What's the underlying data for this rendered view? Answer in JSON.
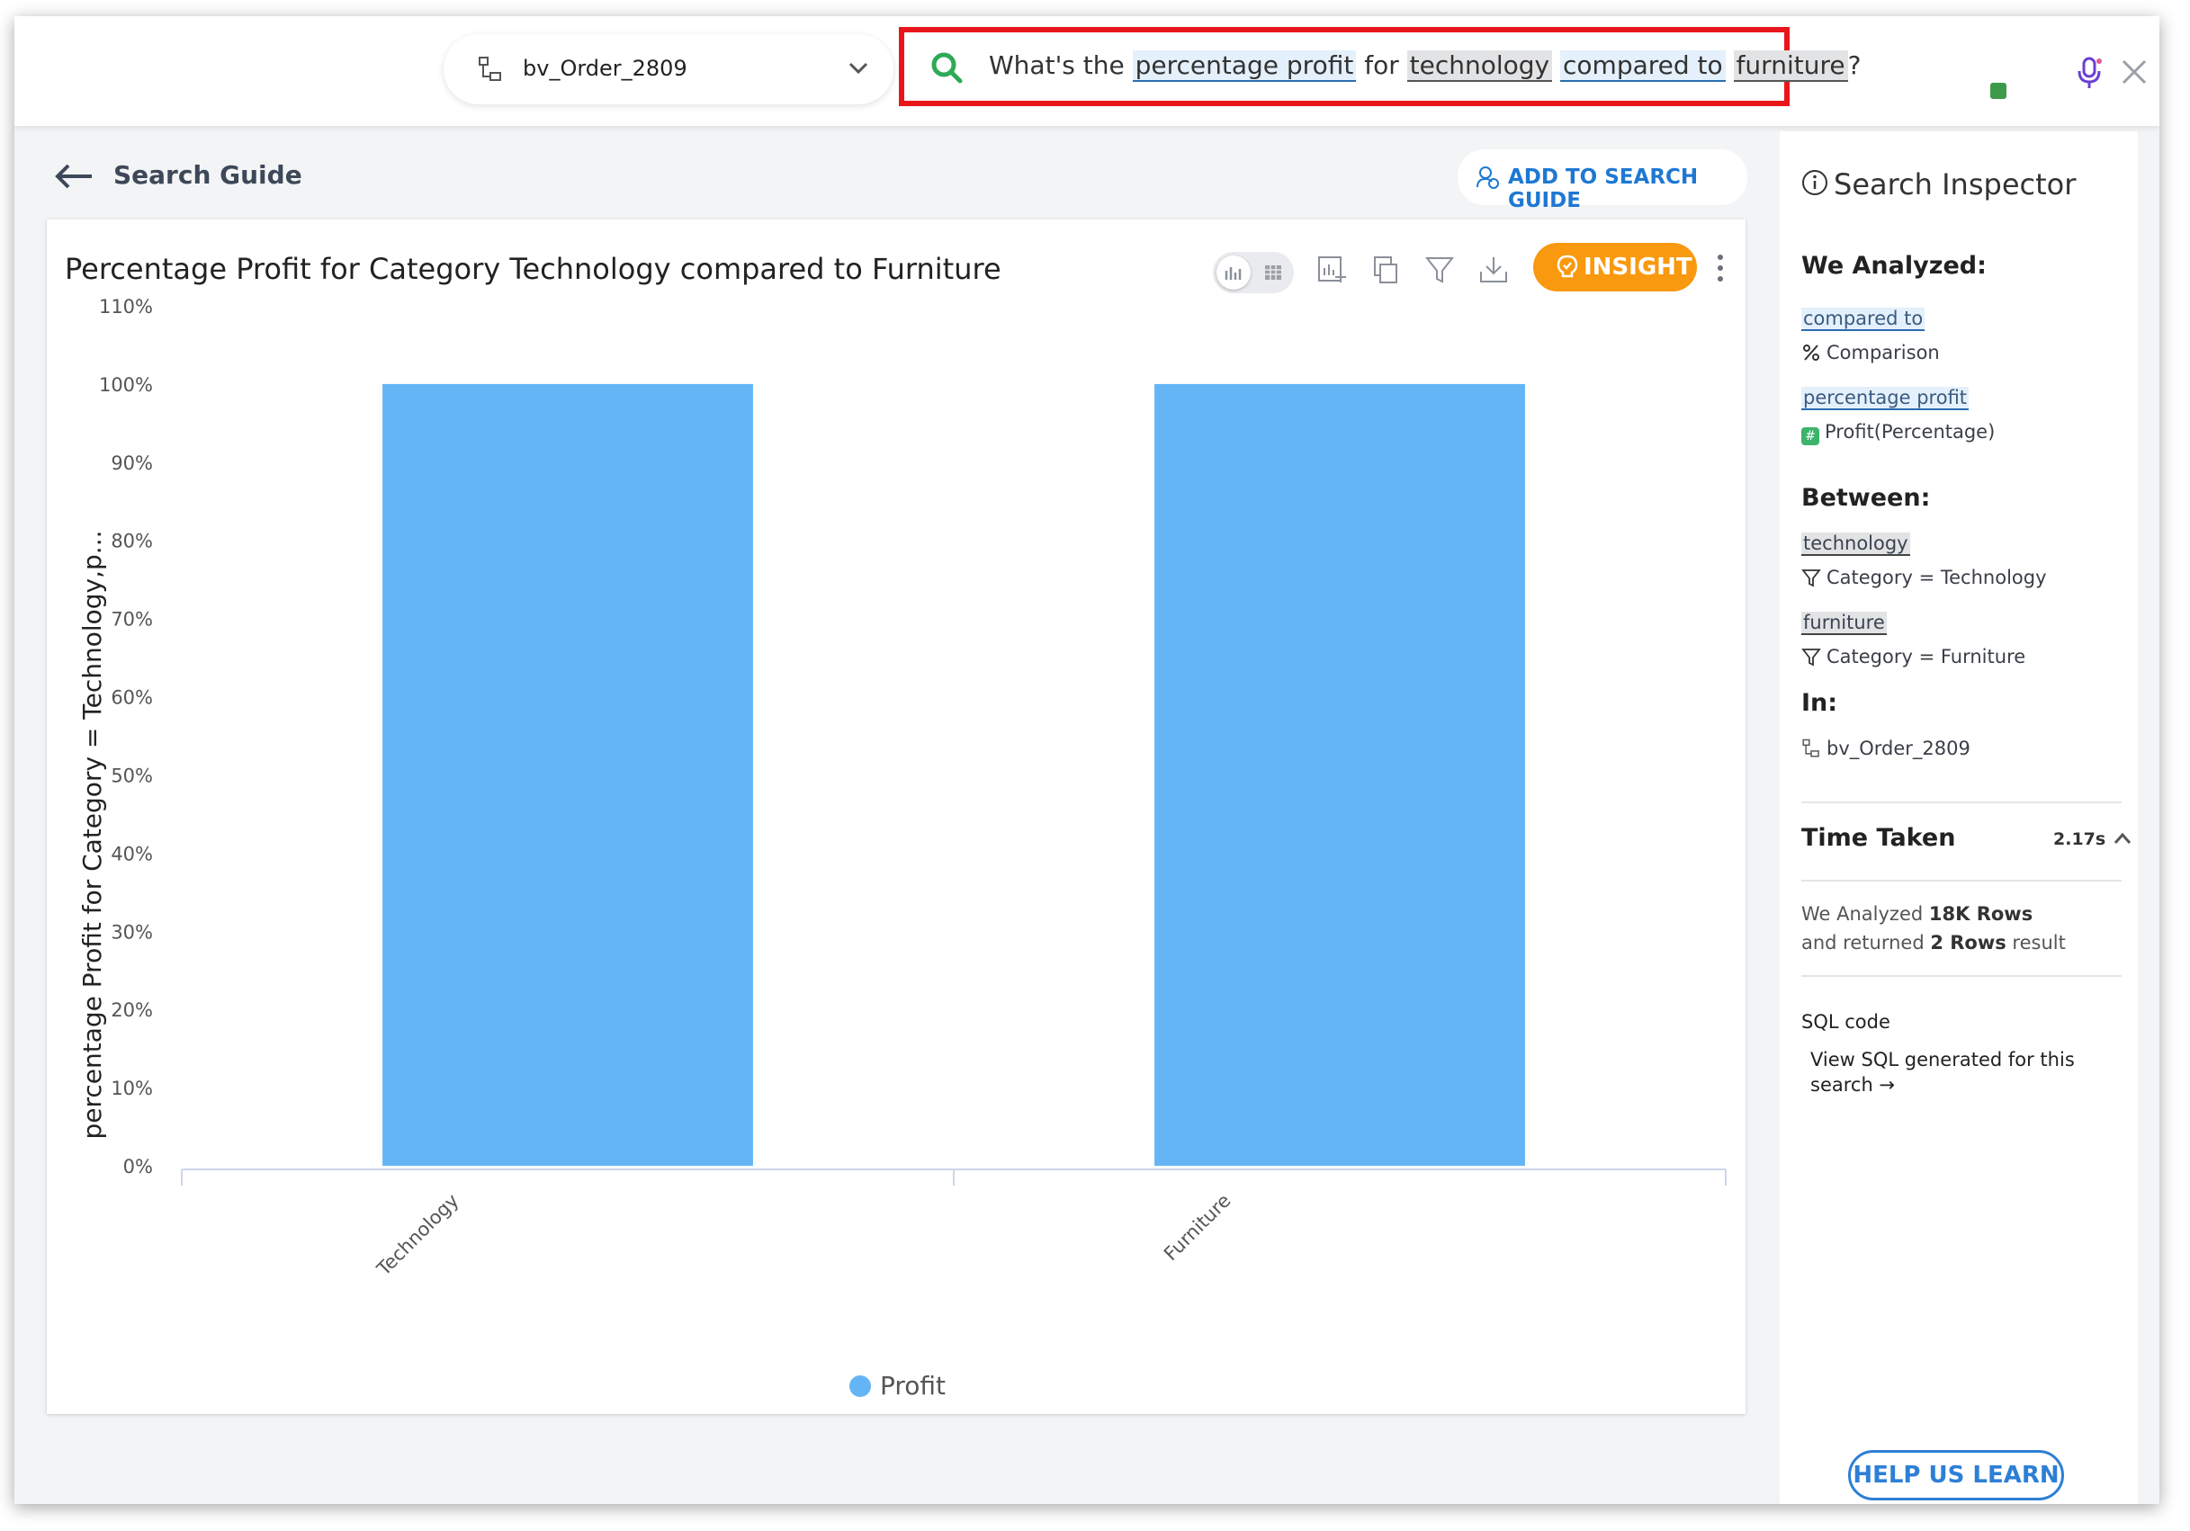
{
  "topbar": {
    "dataset_name": "bv_Order_2809",
    "query": {
      "prefix": "What's the ",
      "tok1": "percentage profit",
      "mid1": " for ",
      "tok2": "technology",
      "mid2": " ",
      "tok3": "compared to",
      "mid3": " ",
      "tok4": "furniture",
      "suffix": "?"
    }
  },
  "guide": {
    "back_label": "Search Guide",
    "add_label": "ADD TO SEARCH GUIDE"
  },
  "card": {
    "insight_label": "INSIGHT"
  },
  "chart_data": {
    "type": "bar",
    "title": "Percentage Profit for Category Technology compared to Furniture",
    "categories": [
      "Technology",
      "Furniture"
    ],
    "series": [
      {
        "name": "Profit",
        "values": [
          100,
          100
        ],
        "color": "#64b5f6"
      }
    ],
    "ylabel": "percentage Profit for Category = Technology,p...",
    "xlabel": "",
    "ylim": [
      0,
      110
    ],
    "yticks": [
      "0%",
      "10%",
      "20%",
      "30%",
      "40%",
      "50%",
      "60%",
      "70%",
      "80%",
      "90%",
      "100%",
      "110%"
    ],
    "legend": "bottom-center",
    "grid": false
  },
  "inspector": {
    "title": "Search Inspector",
    "analyzed_heading": "We Analyzed:",
    "items": [
      {
        "token": "compared to",
        "desc": "Comparison"
      },
      {
        "token": "percentage profit",
        "desc": "Profit(Percentage)"
      }
    ],
    "between_heading": "Between:",
    "between": [
      {
        "token": "technology",
        "desc": "Category = Technology"
      },
      {
        "token": "furniture",
        "desc": "Category = Furniture"
      }
    ],
    "in_heading": "In:",
    "in_dataset": "bv_Order_2809",
    "time_title": "Time Taken",
    "time_value": "2.17s",
    "analyzed_line1_pre": "We Analyzed ",
    "analyzed_line1_bold": "18K Rows",
    "analyzed_line2_pre": "and returned ",
    "analyzed_line2_bold": "2 Rows",
    "analyzed_line2_post": " result",
    "sql_label": "SQL code",
    "sql_link": "View SQL generated for this search →",
    "help_label": "HELP US LEARN"
  }
}
